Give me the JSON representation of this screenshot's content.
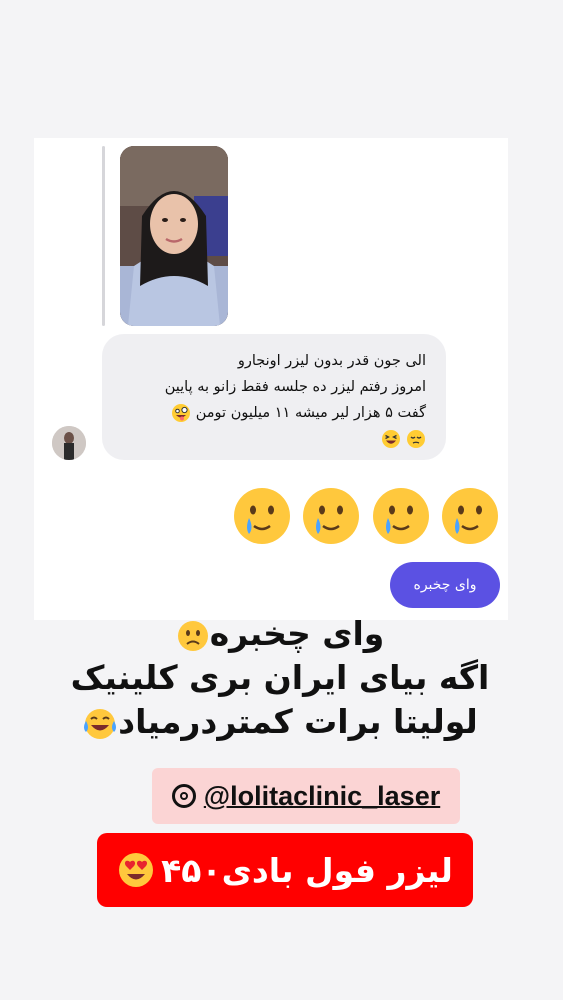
{
  "story_reply": {
    "message_lines": [
      "الی جون قدر بدون لیزر اونجارو",
      "امروز رفتم لیزر ده جلسه فقط زانو به پایین",
      "گفت ۵ هزار لیر میشه ۱۱ میلیون تومن",
      ""
    ],
    "message_emoji": [
      "zany-face-emoji",
      "laughing-face-emoji",
      "pensive-face-emoji"
    ]
  },
  "reaction_emojis": [
    "crying-smile-emoji",
    "crying-smile-emoji",
    "crying-smile-emoji",
    "crying-smile-emoji"
  ],
  "sent_message": "وای چخبره",
  "caption": {
    "line1": "وای چخبره",
    "line2": "اگه بیای ایران بری کلینیک",
    "line3": "لولیتا برات کمتردرمیاد"
  },
  "instagram_handle": "@lolitaclinic_laser",
  "promo_text": "لیزر فول بادی۴۵۰",
  "colors": {
    "sent_bubble": "#5b51e3",
    "received_bubble": "#efeff2",
    "promo_bg": "#ff0000",
    "handle_bg": "#fbd4d4"
  }
}
